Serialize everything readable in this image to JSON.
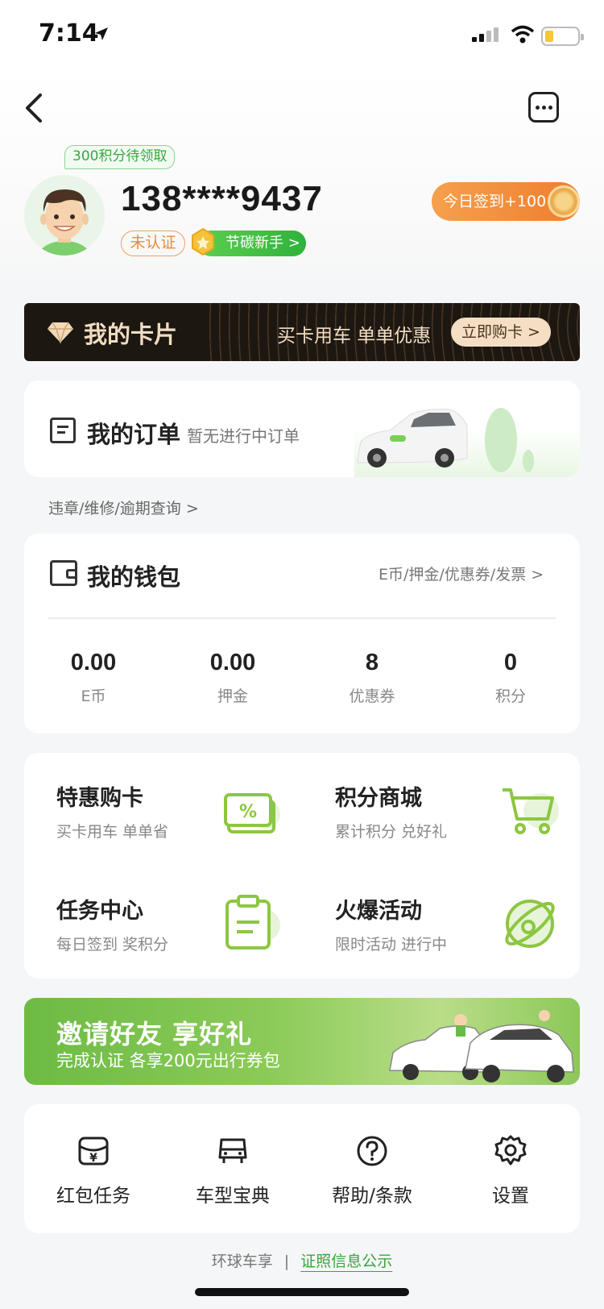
{
  "status_bar": {
    "time": "7:14"
  },
  "profile": {
    "points_pending": "300积分待领取",
    "phone": "138****9437",
    "verification": "未认证",
    "badge": "节碳新手 >",
    "checkin_label": "今日签到+100"
  },
  "card_banner": {
    "title": "我的卡片",
    "promo": "买卡用车 单单优惠",
    "button": "立即购卡 >"
  },
  "orders": {
    "title": "我的订单",
    "subtitle": "暂无进行中订单",
    "query_link": "违章/维修/逾期查询 >"
  },
  "wallet": {
    "title": "我的钱包",
    "link": "E币/押金/优惠券/发票 >",
    "stats": [
      {
        "value": "0.00",
        "label": "E币"
      },
      {
        "value": "0.00",
        "label": "押金"
      },
      {
        "value": "8",
        "label": "优惠券"
      },
      {
        "value": "0",
        "label": "积分"
      }
    ]
  },
  "services": [
    {
      "title": "特惠购卡",
      "subtitle": "买卡用车 单单省",
      "icon": "discount-card-icon"
    },
    {
      "title": "积分商城",
      "subtitle": "累计积分 兑好礼",
      "icon": "cart-icon"
    },
    {
      "title": "任务中心",
      "subtitle": "每日签到 奖积分",
      "icon": "clipboard-icon"
    },
    {
      "title": "火爆活动",
      "subtitle": "限时活动 进行中",
      "icon": "planet-icon"
    }
  ],
  "invite": {
    "title": "邀请好友  享好礼",
    "subtitle": "完成认证  各享200元出行券包"
  },
  "tools": [
    {
      "label": "红包任务",
      "icon": "red-packet-icon"
    },
    {
      "label": "车型宝典",
      "icon": "car-icon"
    },
    {
      "label": "帮助/条款",
      "icon": "help-icon"
    },
    {
      "label": "设置",
      "icon": "gear-icon"
    }
  ],
  "footer": {
    "brand": "环球车享",
    "separator": "|",
    "link": "证照信息公示"
  },
  "colors": {
    "brand_green": "#3aa53e",
    "accent_orange": "#ee7e2e",
    "card_gold": "#f0dcc0"
  }
}
